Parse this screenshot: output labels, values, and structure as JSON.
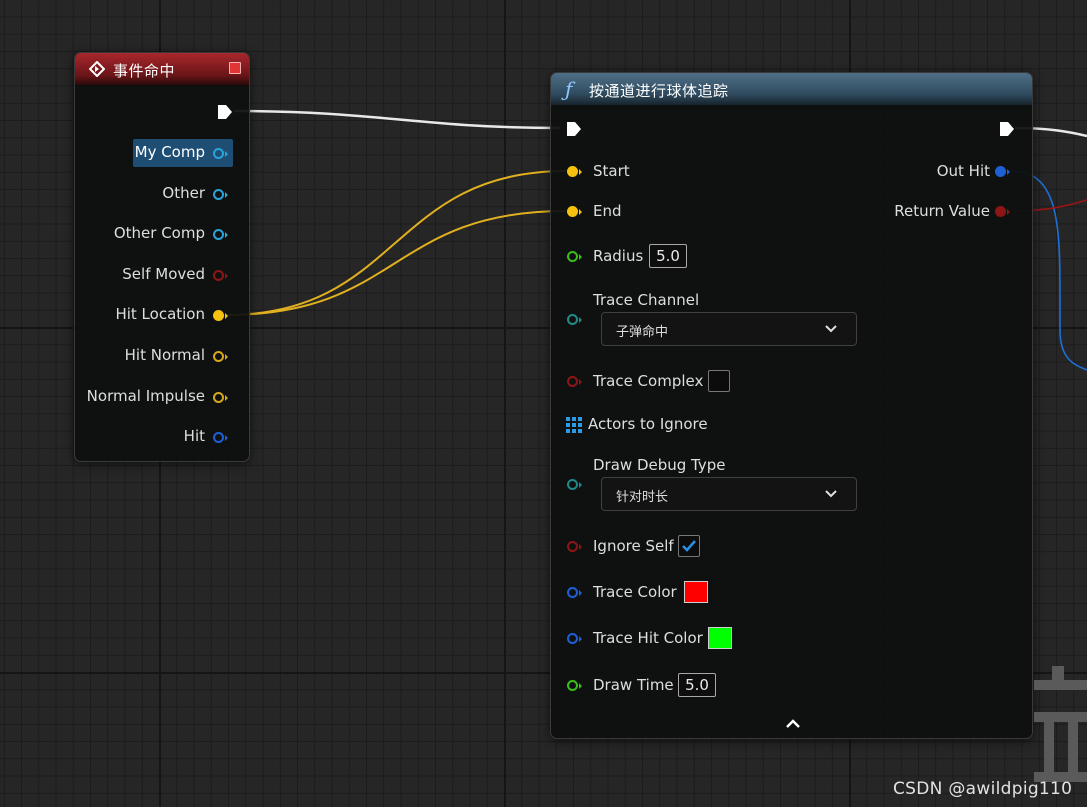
{
  "event_node": {
    "title": "事件命中",
    "pins": [
      {
        "label": "My Comp",
        "color": "#27a4dc",
        "highlighted": true
      },
      {
        "label": "Other",
        "color": "#27a4dc"
      },
      {
        "label": "Other Comp",
        "color": "#27a4dc"
      },
      {
        "label": "Self Moved",
        "color": "#8e1515"
      },
      {
        "label": "Hit Location",
        "color": "#f7c20f"
      },
      {
        "label": "Hit Normal",
        "color": "#d6a91a"
      },
      {
        "label": "Normal Impulse",
        "color": "#d6a91a"
      },
      {
        "label": "Hit",
        "color": "#1e5fd6"
      }
    ]
  },
  "func_node": {
    "title": "按通道进行球体追踪",
    "outputs": {
      "out_hit": "Out Hit",
      "return_value": "Return Value"
    },
    "inputs": {
      "start": "Start",
      "end": "End",
      "radius": {
        "label": "Radius",
        "value": "5.0"
      },
      "trace_channel": {
        "label": "Trace Channel",
        "value": "子弹命中"
      },
      "trace_complex": {
        "label": "Trace Complex",
        "checked": false
      },
      "actors_to_ignore": "Actors to Ignore",
      "draw_debug_type": {
        "label": "Draw Debug Type",
        "value": "针对时长"
      },
      "ignore_self": {
        "label": "Ignore Self",
        "checked": true
      },
      "trace_color": {
        "label": "Trace Color",
        "color": "#ff0000"
      },
      "trace_hit_color": {
        "label": "Trace Hit Color",
        "color": "#00ff00"
      },
      "draw_time": {
        "label": "Draw Time",
        "value": "5.0"
      }
    }
  },
  "colors": {
    "exec_wire": "#e8e8e8",
    "vector_wire": "#e0b020",
    "struct_wire": "#1f6fd6",
    "bool_wire": "#9a1515",
    "float_pin": "#38c016",
    "name_pin": "#1f8a8a",
    "bool_pin": "#8e1515",
    "color_pin": "#1e5fd6",
    "vector_pin": "#f7c20f"
  },
  "watermark": "CSDN @awildpig110"
}
